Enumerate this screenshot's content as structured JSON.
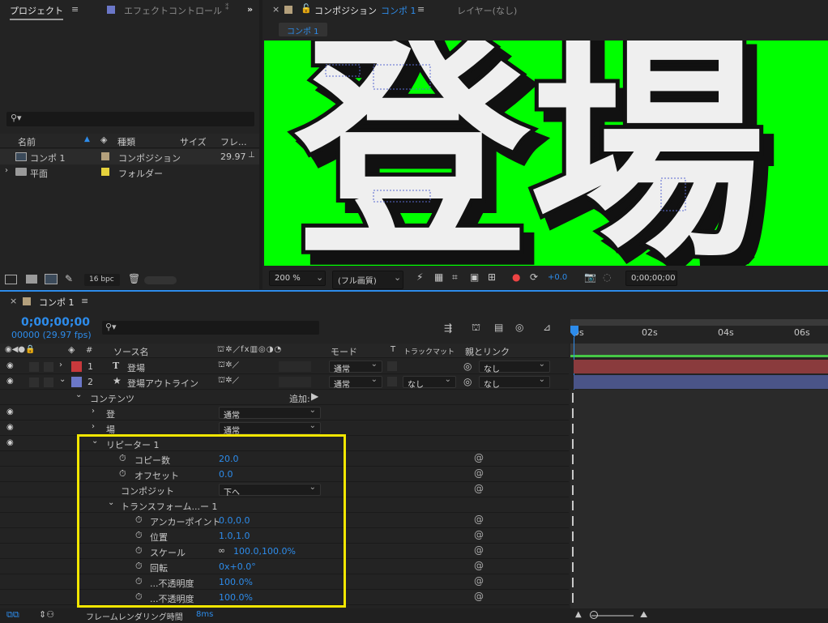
{
  "project": {
    "tab_label": "プロジェクト",
    "effect_tab_label": "エフェクトコントロール",
    "columns": {
      "name": "名前",
      "type": "種類",
      "size": "サイズ",
      "frame": "フレ..."
    },
    "items": [
      {
        "name": "コンポ 1",
        "type": "コンポジション",
        "fps": "29.97",
        "color": "#b4a07c"
      },
      {
        "name": "平面",
        "type": "フォルダー",
        "fps": "",
        "color": "#e6d23c"
      }
    ],
    "bpc": "16 bpc"
  },
  "viewer": {
    "tab_prefix": "コンポジション",
    "comp_name": "コンポ 1",
    "layer_tab": "レイヤー(なし)",
    "comp_button": "コンポ 1",
    "canvas_text": "登場",
    "zoom": "200 %",
    "quality": "(フル画質)",
    "exposure": "+0.0",
    "timecode": "0;00;00;00"
  },
  "timeline": {
    "tab": "コンポ 1",
    "timecode": "0;00;00;00",
    "frames": "00000 (29.97 fps)",
    "columns": {
      "num": "#",
      "source": "ソース名",
      "mode": "モード",
      "t": "T",
      "trackmatte": "トラックマット",
      "parent": "親とリンク"
    },
    "ruler": [
      "0s",
      "02s",
      "04s",
      "06s"
    ],
    "layers": [
      {
        "num": "1",
        "type_icon": "T",
        "name": "登場",
        "mode": "通常",
        "matte": "",
        "parent": "なし",
        "color": "#c8393c",
        "bar": "#8a3b3d"
      },
      {
        "num": "2",
        "type_icon": "★",
        "name": "登場アウトライン",
        "mode": "通常",
        "matte": "なし",
        "parent": "なし",
        "color": "#6b77c8",
        "bar": "#4a5488"
      }
    ],
    "contents_label": "コンテンツ",
    "add_label": "追加:",
    "groups": [
      {
        "name": "登",
        "mode": "通常"
      },
      {
        "name": "場",
        "mode": "通常"
      }
    ],
    "repeater": {
      "label": "リピーター 1",
      "copies_label": "コピー数",
      "copies": "20.0",
      "offset_label": "オフセット",
      "offset": "0.0",
      "composite_label": "コンポジット",
      "composite": "下へ",
      "transform_label": "トランスフォーム...ー 1",
      "anchor_label": "アンカーポイント",
      "anchor": "0.0,0.0",
      "position_label": "位置",
      "position": "1.0,1.0",
      "scale_label": "スケール",
      "scale": "100.0,100.0%",
      "rotation_label": "回転",
      "rotation": "0x+0.0°",
      "start_opacity_label": "...不透明度",
      "start_opacity": "100.0%",
      "end_opacity_label": "...不透明度",
      "end_opacity": "100.0%"
    },
    "footer_label": "フレームレンダリング時間",
    "footer_value": "8ms"
  },
  "colors": {
    "accent": "#2d8ceb",
    "highlight": "#f2e600",
    "canvas": "#00ff00"
  }
}
